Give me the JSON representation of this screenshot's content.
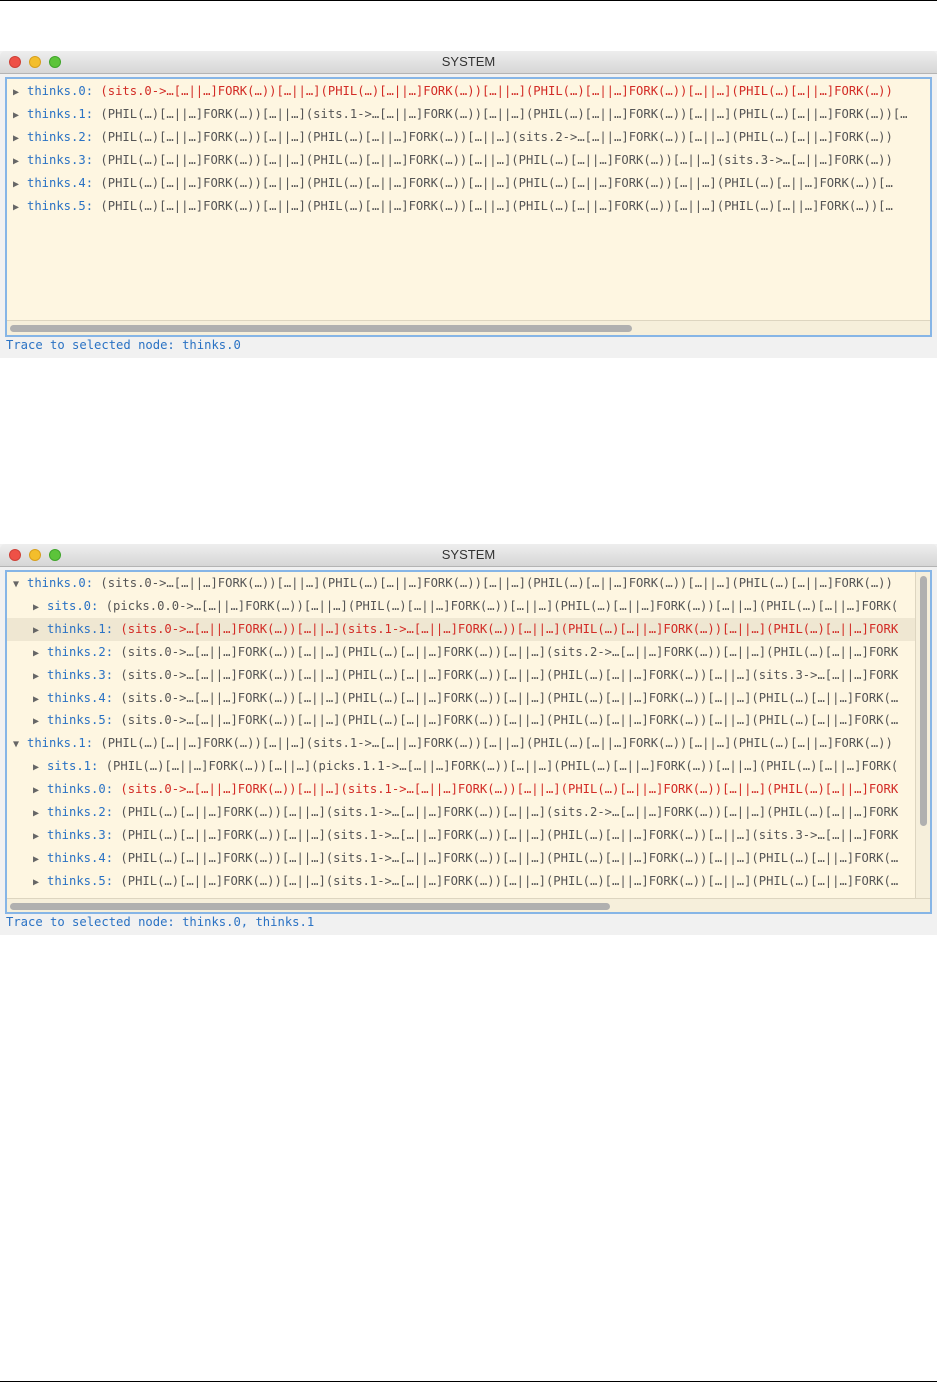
{
  "window1": {
    "title": "SYSTEM",
    "status": "Trace to selected node: thinks.0",
    "rows": [
      {
        "key": "thinks.0:",
        "value": "(sits.0->…[…||…]FORK(…))[…||…](PHIL(…)[…||…]FORK(…))[…||…](PHIL(…)[…||…]FORK(…))[…||…](PHIL(…)[…||…]FORK(…))",
        "expanded": false,
        "trace": true
      },
      {
        "key": "thinks.1:",
        "value": "(PHIL(…)[…||…]FORK(…))[…||…](sits.1->…[…||…]FORK(…))[…||…](PHIL(…)[…||…]FORK(…))[…||…](PHIL(…)[…||…]FORK(…))[…",
        "expanded": false,
        "trace": false
      },
      {
        "key": "thinks.2:",
        "value": "(PHIL(…)[…||…]FORK(…))[…||…](PHIL(…)[…||…]FORK(…))[…||…](sits.2->…[…||…]FORK(…))[…||…](PHIL(…)[…||…]FORK(…))",
        "expanded": false,
        "trace": false
      },
      {
        "key": "thinks.3:",
        "value": "(PHIL(…)[…||…]FORK(…))[…||…](PHIL(…)[…||…]FORK(…))[…||…](PHIL(…)[…||…]FORK(…))[…||…](sits.3->…[…||…]FORK(…))",
        "expanded": false,
        "trace": false
      },
      {
        "key": "thinks.4:",
        "value": "(PHIL(…)[…||…]FORK(…))[…||…](PHIL(…)[…||…]FORK(…))[…||…](PHIL(…)[…||…]FORK(…))[…||…](PHIL(…)[…||…]FORK(…))[…",
        "expanded": false,
        "trace": false
      },
      {
        "key": "thinks.5:",
        "value": "(PHIL(…)[…||…]FORK(…))[…||…](PHIL(…)[…||…]FORK(…))[…||…](PHIL(…)[…||…]FORK(…))[…||…](PHIL(…)[…||…]FORK(…))[…",
        "expanded": false,
        "trace": false
      }
    ]
  },
  "window2": {
    "title": "SYSTEM",
    "status": "Trace to selected node: thinks.0, thinks.1",
    "rows": [
      {
        "key": "thinks.0:",
        "value": "(sits.0->…[…||…]FORK(…))[…||…](PHIL(…)[…||…]FORK(…))[…||…](PHIL(…)[…||…]FORK(…))[…||…](PHIL(…)[…||…]FORK(…))",
        "expanded": true,
        "trace": false,
        "indent": 0
      },
      {
        "key": "sits.0:",
        "value": "(picks.0.0->…[…||…]FORK(…))[…||…](PHIL(…)[…||…]FORK(…))[…||…](PHIL(…)[…||…]FORK(…))[…||…](PHIL(…)[…||…]FORK(",
        "expanded": false,
        "trace": false,
        "indent": 1
      },
      {
        "key": "thinks.1:",
        "value": "(sits.0->…[…||…]FORK(…))[…||…](sits.1->…[…||…]FORK(…))[…||…](PHIL(…)[…||…]FORK(…))[…||…](PHIL(…)[…||…]FORK",
        "expanded": false,
        "trace": true,
        "indent": 1,
        "selected": true
      },
      {
        "key": "thinks.2:",
        "value": "(sits.0->…[…||…]FORK(…))[…||…](PHIL(…)[…||…]FORK(…))[…||…](sits.2->…[…||…]FORK(…))[…||…](PHIL(…)[…||…]FORK",
        "expanded": false,
        "trace": false,
        "indent": 1
      },
      {
        "key": "thinks.3:",
        "value": "(sits.0->…[…||…]FORK(…))[…||…](PHIL(…)[…||…]FORK(…))[…||…](PHIL(…)[…||…]FORK(…))[…||…](sits.3->…[…||…]FORK",
        "expanded": false,
        "trace": false,
        "indent": 1
      },
      {
        "key": "thinks.4:",
        "value": "(sits.0->…[…||…]FORK(…))[…||…](PHIL(…)[…||…]FORK(…))[…||…](PHIL(…)[…||…]FORK(…))[…||…](PHIL(…)[…||…]FORK(…",
        "expanded": false,
        "trace": false,
        "indent": 1
      },
      {
        "key": "thinks.5:",
        "value": "(sits.0->…[…||…]FORK(…))[…||…](PHIL(…)[…||…]FORK(…))[…||…](PHIL(…)[…||…]FORK(…))[…||…](PHIL(…)[…||…]FORK(…",
        "expanded": false,
        "trace": false,
        "indent": 1
      },
      {
        "key": "thinks.1:",
        "value": "(PHIL(…)[…||…]FORK(…))[…||…](sits.1->…[…||…]FORK(…))[…||…](PHIL(…)[…||…]FORK(…))[…||…](PHIL(…)[…||…]FORK(…))",
        "expanded": true,
        "trace": false,
        "indent": 0
      },
      {
        "key": "sits.1:",
        "value": "(PHIL(…)[…||…]FORK(…))[…||…](picks.1.1->…[…||…]FORK(…))[…||…](PHIL(…)[…||…]FORK(…))[…||…](PHIL(…)[…||…]FORK(",
        "expanded": false,
        "trace": false,
        "indent": 1
      },
      {
        "key": "thinks.0:",
        "value": "(sits.0->…[…||…]FORK(…))[…||…](sits.1->…[…||…]FORK(…))[…||…](PHIL(…)[…||…]FORK(…))[…||…](PHIL(…)[…||…]FORK",
        "expanded": false,
        "trace": true,
        "indent": 1
      },
      {
        "key": "thinks.2:",
        "value": "(PHIL(…)[…||…]FORK(…))[…||…](sits.1->…[…||…]FORK(…))[…||…](sits.2->…[…||…]FORK(…))[…||…](PHIL(…)[…||…]FORK",
        "expanded": false,
        "trace": false,
        "indent": 1
      },
      {
        "key": "thinks.3:",
        "value": "(PHIL(…)[…||…]FORK(…))[…||…](sits.1->…[…||…]FORK(…))[…||…](PHIL(…)[…||…]FORK(…))[…||…](sits.3->…[…||…]FORK",
        "expanded": false,
        "trace": false,
        "indent": 1
      },
      {
        "key": "thinks.4:",
        "value": "(PHIL(…)[…||…]FORK(…))[…||…](sits.1->…[…||…]FORK(…))[…||…](PHIL(…)[…||…]FORK(…))[…||…](PHIL(…)[…||…]FORK(…",
        "expanded": false,
        "trace": false,
        "indent": 1
      },
      {
        "key": "thinks.5:",
        "value": "(PHIL(…)[…||…]FORK(…))[…||…](sits.1->…[…||…]FORK(…))[…||…](PHIL(…)[…||…]FORK(…))[…||…](PHIL(…)[…||…]FORK(…",
        "expanded": false,
        "trace": false,
        "indent": 1
      }
    ]
  }
}
